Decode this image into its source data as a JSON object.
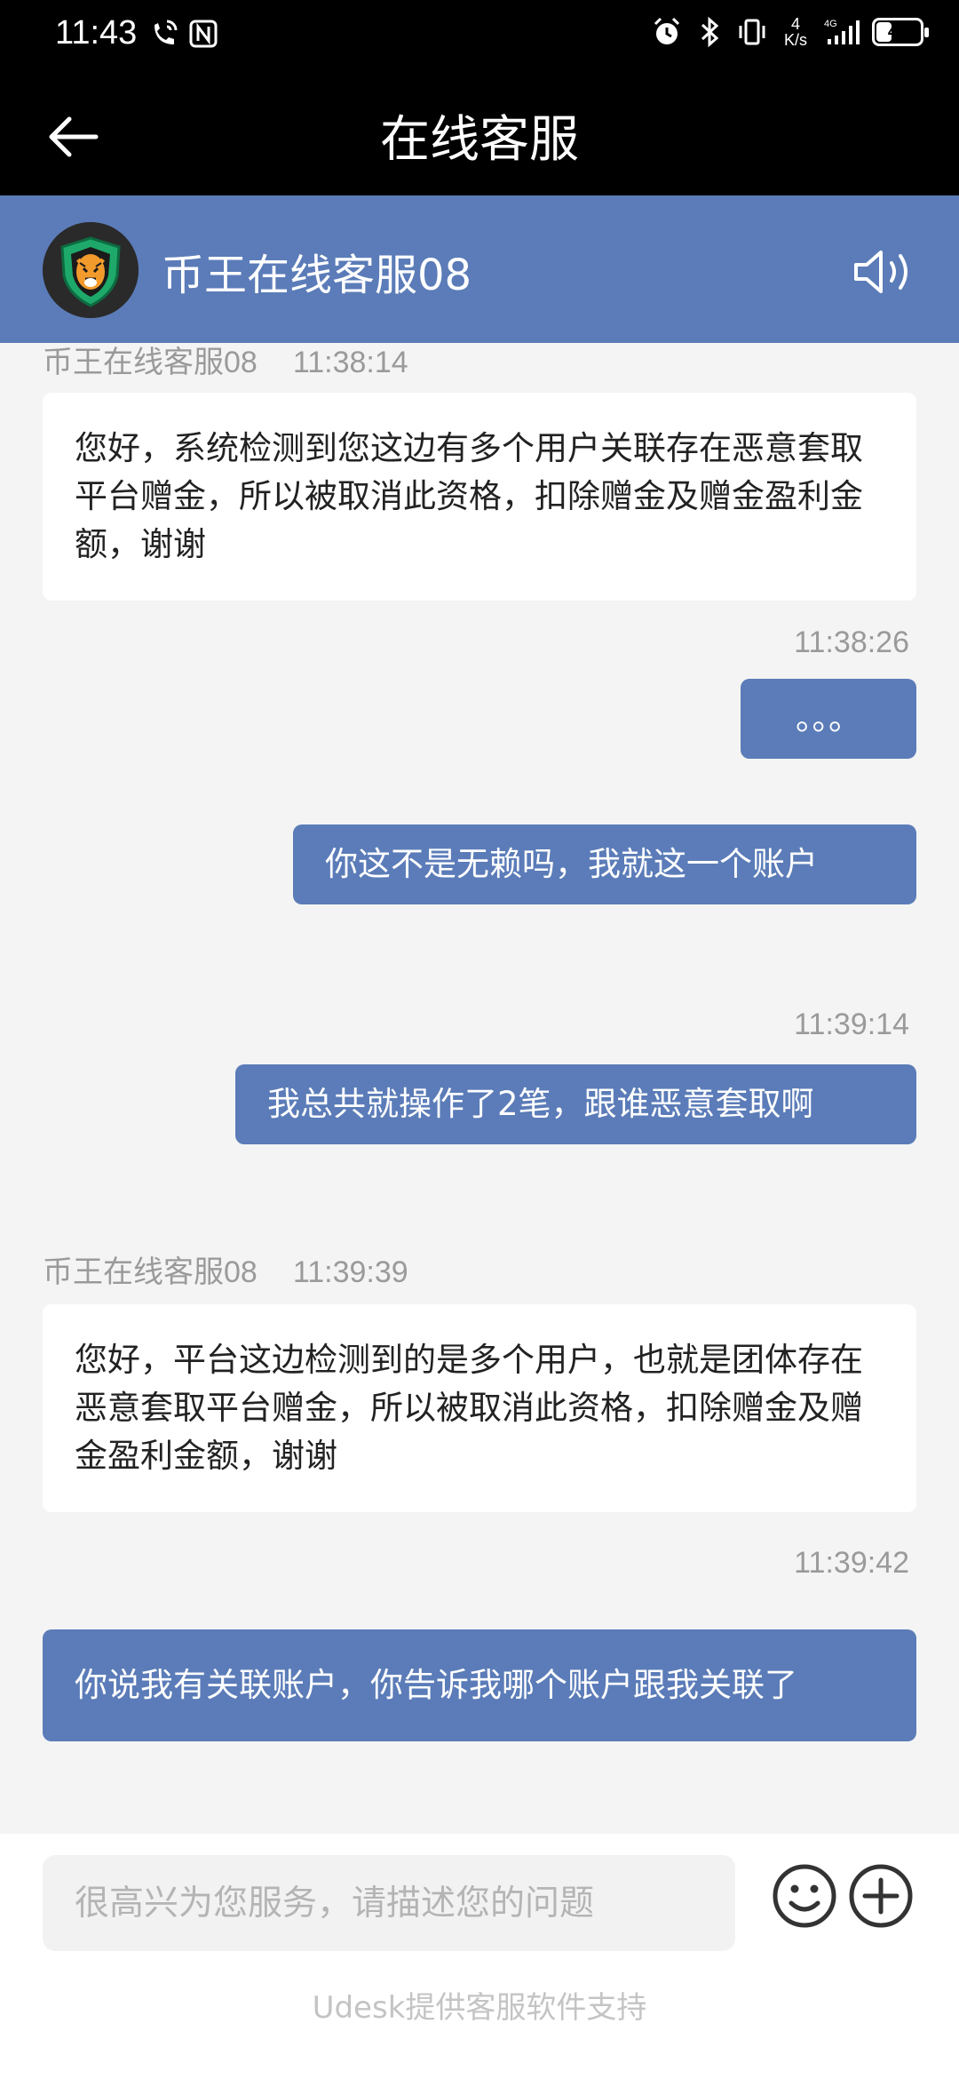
{
  "status_bar": {
    "time": "11:43",
    "net_speed_value": "4",
    "net_speed_unit": "K/s",
    "battery": "41",
    "battery_level": 0.41
  },
  "title_bar": {
    "title": "在线客服"
  },
  "agent": {
    "name": "币王在线客服08"
  },
  "messages": [
    {
      "sender": "币王在线客服08",
      "time": "11:38:14",
      "text": "您好，系统检测到您这边有多个用户关联存在恶意套取平台赠金，所以被取消此资格，扣除赠金及赠金盈利金额，谢谢"
    },
    {
      "time": "11:38:26",
      "text": "。。。"
    },
    {
      "text": "你这不是无赖吗，我就这一个账户"
    },
    {
      "time": "11:39:14",
      "text": "我总共就操作了2笔，跟谁恶意套取啊"
    },
    {
      "sender": "币王在线客服08",
      "time": "11:39:39",
      "text": "您好，平台这边检测到的是多个用户，也就是团体存在恶意套取平台赠金，所以被取消此资格，扣除赠金及赠金盈利金额，谢谢"
    },
    {
      "time": "11:39:42",
      "text": "你说我有关联账户，你告诉我哪个账户跟我关联了"
    }
  ],
  "input": {
    "placeholder": "很高兴为您服务，请描述您的问题"
  },
  "footer": {
    "text": "Udesk提供客服软件支持"
  },
  "icons": {
    "back": "arrow-left-icon",
    "speaker": "speaker-icon",
    "emoji": "smiley-icon",
    "plus": "plus-circle-icon"
  },
  "colors": {
    "accent": "#5b7cb8",
    "header_bg": "#000000",
    "chat_bg": "#f4f4f4",
    "incoming_bubble": "#ffffff",
    "outgoing_bubble": "#5b7cb8"
  }
}
